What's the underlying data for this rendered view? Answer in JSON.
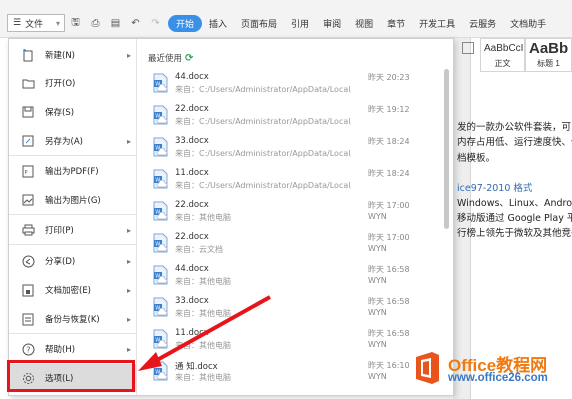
{
  "toolbar": {
    "file_label": "文件",
    "tabs": [
      "开始",
      "插入",
      "页面布局",
      "引用",
      "审阅",
      "视图",
      "章节",
      "开发工具",
      "云服务",
      "文档助手"
    ]
  },
  "styles": [
    {
      "sample": "AaBbCcI",
      "label": "正文"
    },
    {
      "sample": "AaBb",
      "label": "标题 1"
    }
  ],
  "document": {
    "lines": [
      "发的一款办公软件套装，可",
      "内存占用低、运行速度快、体",
      "档模板。",
      "ice97-2010 格式",
      "Windows、Linux、Android、",
      "移动版通过 Google Play 平台",
      "行榜上领先于微软及其他竞争"
    ]
  },
  "file_menu": {
    "items": [
      {
        "label": "新建(N)",
        "icon": "new-doc-icon",
        "arrow": true
      },
      {
        "label": "打开(O)",
        "icon": "folder-open-icon",
        "arrow": false
      },
      {
        "label": "保存(S)",
        "icon": "save-icon",
        "arrow": false
      },
      {
        "label": "另存为(A)",
        "icon": "save-as-icon",
        "arrow": true
      },
      {
        "label": "输出为PDF(F)",
        "icon": "pdf-icon",
        "arrow": false
      },
      {
        "label": "输出为图片(G)",
        "icon": "image-export-icon",
        "arrow": false
      },
      {
        "label": "打印(P)",
        "icon": "print-icon",
        "arrow": true
      },
      {
        "label": "分享(D)",
        "icon": "share-icon",
        "arrow": true
      },
      {
        "label": "文档加密(E)",
        "icon": "encrypt-icon",
        "arrow": true
      },
      {
        "label": "备份与恢复(K)",
        "icon": "backup-icon",
        "arrow": true
      },
      {
        "label": "帮助(H)",
        "icon": "help-icon",
        "arrow": true
      },
      {
        "label": "选项(L)",
        "icon": "gear-icon",
        "arrow": false
      }
    ],
    "recent_title": "最近使用",
    "recent": [
      {
        "name": "44.docx",
        "path": "来自：C:/Users/Administrator/AppData/Local/ki...",
        "time": "昨天 20:23",
        "who": ""
      },
      {
        "name": "22.docx",
        "path": "来自：C:/Users/Administrator/AppData/Local/ki...",
        "time": "昨天 19:12",
        "who": ""
      },
      {
        "name": "33.docx",
        "path": "来自：C:/Users/Administrator/AppData/Local/ki...",
        "time": "昨天 18:24",
        "who": ""
      },
      {
        "name": "11.docx",
        "path": "来自：C:/Users/Administrator/AppData/Local/ki...",
        "time": "昨天 18:24",
        "who": ""
      },
      {
        "name": "22.docx",
        "path": "来自：其他电脑",
        "time": "昨天 17:00",
        "who": "WYN"
      },
      {
        "name": "22.docx",
        "path": "来自：云文档",
        "time": "昨天 17:00",
        "who": "WYN"
      },
      {
        "name": "44.docx",
        "path": "来自：其他电脑",
        "time": "昨天 16:58",
        "who": "WYN"
      },
      {
        "name": "33.docx",
        "path": "来自：其他电脑",
        "time": "昨天 16:58",
        "who": "WYN"
      },
      {
        "name": "11.docx",
        "path": "来自：其他电脑",
        "time": "昨天 16:58",
        "who": "WYN"
      },
      {
        "name": "通     知.docx",
        "path": "来自：其他电脑",
        "time": "昨天 16:10",
        "who": "WYN"
      }
    ]
  },
  "watermark": {
    "line1": "Office教程网",
    "line2": "www.office26.com"
  },
  "colors": {
    "accent": "#3a8fe6",
    "highlight": "#e8141b",
    "wm_orange": "#f07a10",
    "wm_blue": "#3a78c4"
  }
}
